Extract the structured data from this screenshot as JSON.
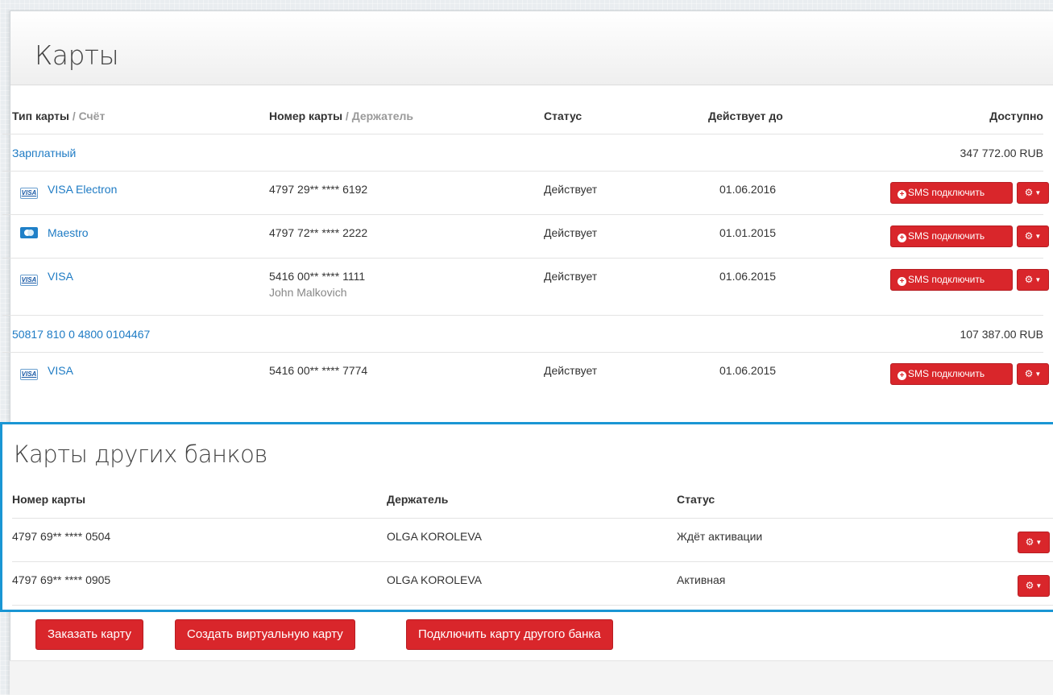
{
  "page": {
    "title": "Карты"
  },
  "cards_table": {
    "headers": {
      "type": "Тип карты",
      "account": "Счёт",
      "number": "Номер карты",
      "holder": "Держатель",
      "status": "Статус",
      "valid": "Действует до",
      "available": "Доступно",
      "sep": " / "
    },
    "groups": [
      {
        "account": "Зарплатный",
        "balance": "347 772.00 RUB",
        "cards": [
          {
            "brand": "VISA Electron",
            "icon": "visa-icon",
            "number": "4797 29** **** 6192",
            "holder": "",
            "status": "Действует",
            "valid": "01.06.2016"
          },
          {
            "brand": "Maestro",
            "icon": "maestro-icon",
            "number": "4797 72** **** 2222",
            "holder": "",
            "status": "Действует",
            "valid": "01.01.2015"
          },
          {
            "brand": "VISA",
            "icon": "visa-icon",
            "number": "5416 00** **** 1111",
            "holder": "John Malkovich",
            "status": "Действует",
            "valid": "01.06.2015"
          }
        ]
      },
      {
        "account": "50817 810 0 4800 0104467",
        "balance": "107 387.00 RUB",
        "cards": [
          {
            "brand": "VISA",
            "icon": "visa-icon",
            "number": "5416 00** **** 7774",
            "holder": "",
            "status": "Действует",
            "valid": "01.06.2015"
          }
        ]
      }
    ],
    "sms_label": "SMS подключить",
    "visa_mark": "VISA"
  },
  "other_banks": {
    "title": "Карты других банков",
    "headers": {
      "number": "Номер карты",
      "holder": "Держатель",
      "status": "Статус"
    },
    "rows": [
      {
        "number": "4797 69** **** 0504",
        "holder": "OLGA KOROLEVA",
        "status": "Ждёт активации"
      },
      {
        "number": "4797 69** **** 0905",
        "holder": "OLGA KOROLEVA",
        "status": "Активная"
      }
    ]
  },
  "actions": {
    "order": "Заказать карту",
    "virtual": "Создать виртуальную карту",
    "connect": "Подключить карту другого банка"
  },
  "colors": {
    "accent_red": "#d9262b",
    "link_blue": "#1e7bc4",
    "highlight_border": "#1a96d4"
  }
}
